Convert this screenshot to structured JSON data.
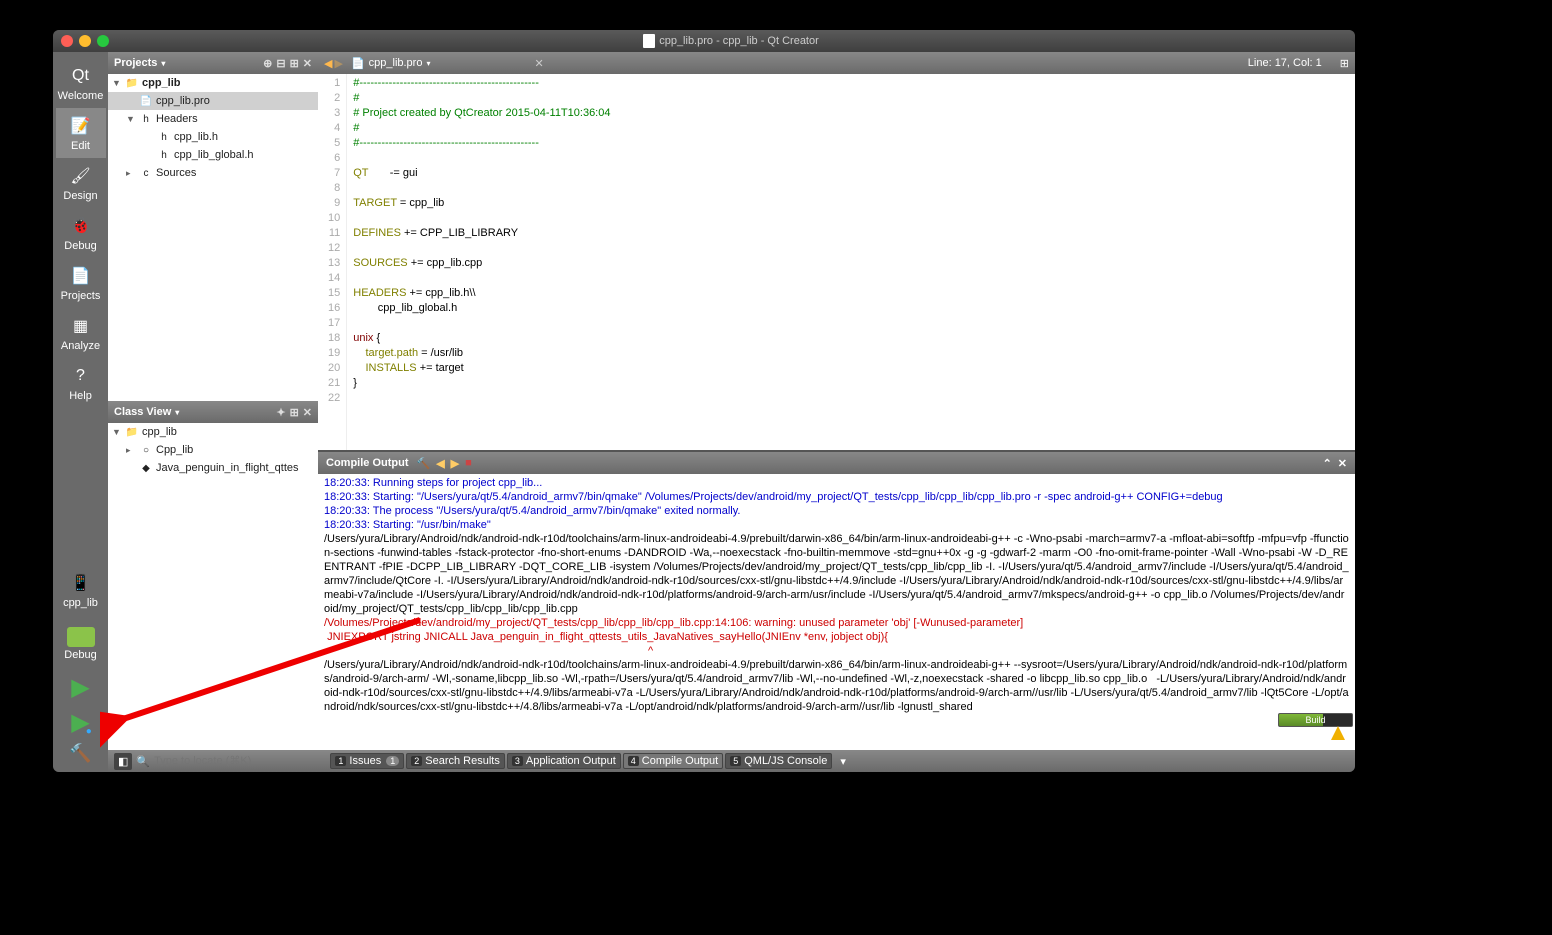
{
  "window": {
    "title": "cpp_lib.pro - cpp_lib - Qt Creator"
  },
  "sidebar": {
    "items": [
      {
        "label": "Welcome",
        "icon": "Qt"
      },
      {
        "label": "Edit",
        "icon": "📝"
      },
      {
        "label": "Design",
        "icon": "🖌"
      },
      {
        "label": "Debug",
        "icon": "🐞"
      },
      {
        "label": "Projects",
        "icon": "📄"
      },
      {
        "label": "Analyze",
        "icon": "▦"
      },
      {
        "label": "Help",
        "icon": "?"
      }
    ],
    "project": "cpp_lib",
    "mode": "Debug"
  },
  "projects_panel": {
    "title": "Projects",
    "tree": [
      {
        "l": 0,
        "arrow": "▼",
        "icon": "📁",
        "name": "cpp_lib",
        "bold": true
      },
      {
        "l": 1,
        "arrow": "",
        "icon": "📄",
        "name": "cpp_lib.pro",
        "sel": true
      },
      {
        "l": 1,
        "arrow": "▼",
        "icon": "h",
        "name": "Headers"
      },
      {
        "l": 2,
        "arrow": "",
        "icon": "h",
        "name": "cpp_lib.h"
      },
      {
        "l": 2,
        "arrow": "",
        "icon": "h",
        "name": "cpp_lib_global.h"
      },
      {
        "l": 1,
        "arrow": "▸",
        "icon": "c",
        "name": "Sources"
      }
    ]
  },
  "classview_panel": {
    "title": "Class View",
    "tree": [
      {
        "l": 0,
        "arrow": "▼",
        "icon": "📁",
        "name": "cpp_lib"
      },
      {
        "l": 1,
        "arrow": "▸",
        "icon": "○",
        "name": "Cpp_lib"
      },
      {
        "l": 1,
        "arrow": "",
        "icon": "◆",
        "name": "Java_penguin_in_flight_qttes"
      }
    ]
  },
  "editor": {
    "tab": "cpp_lib.pro",
    "cursor": "Line: 17, Col: 1",
    "lines": [
      {
        "n": 1,
        "t": "#-------------------------------------------------",
        "cls": "c-green"
      },
      {
        "n": 2,
        "t": "#",
        "cls": "c-green"
      },
      {
        "n": 3,
        "t": "# Project created by QtCreator 2015-04-11T10:36:04",
        "cls": "c-green"
      },
      {
        "n": 4,
        "t": "#",
        "cls": "c-green"
      },
      {
        "n": 5,
        "t": "#-------------------------------------------------",
        "cls": "c-green"
      },
      {
        "n": 6,
        "t": "",
        "cls": ""
      },
      {
        "n": 7,
        "html": "<span class='c-olive'>QT</span>       -= gui"
      },
      {
        "n": 8,
        "t": "",
        "cls": ""
      },
      {
        "n": 9,
        "html": "<span class='c-olive'>TARGET</span> = cpp_lib"
      },
      {
        "n": 10,
        "t": "",
        "cls": ""
      },
      {
        "n": 11,
        "html": "<span class='c-olive'>DEFINES</span> += CPP_LIB_LIBRARY"
      },
      {
        "n": 12,
        "t": "",
        "cls": ""
      },
      {
        "n": 13,
        "html": "<span class='c-olive'>SOURCES</span> += cpp_lib.cpp"
      },
      {
        "n": 14,
        "t": "",
        "cls": ""
      },
      {
        "n": 15,
        "html": "<span class='c-olive'>HEADERS</span> += cpp_lib.h\\\\"
      },
      {
        "n": 16,
        "t": "        cpp_lib_global.h",
        "cls": ""
      },
      {
        "n": 17,
        "t": "",
        "cls": ""
      },
      {
        "n": 18,
        "html": "<span class='c-maroon'>unix</span> {"
      },
      {
        "n": 19,
        "html": "    <span class='c-olive'>target.path</span> = /usr/lib"
      },
      {
        "n": 20,
        "html": "    <span class='c-olive'>INSTALLS</span> += target"
      },
      {
        "n": 21,
        "t": "}",
        "cls": ""
      },
      {
        "n": 22,
        "t": "",
        "cls": ""
      }
    ]
  },
  "output": {
    "title": "Compile Output",
    "lines": [
      {
        "c": "o-blue",
        "t": "18:20:33: Running steps for project cpp_lib..."
      },
      {
        "c": "o-blue",
        "t": "18:20:33: Starting: \"/Users/yura/qt/5.4/android_armv7/bin/qmake\" /Volumes/Projects/dev/android/my_project/QT_tests/cpp_lib/cpp_lib/cpp_lib.pro -r -spec android-g++ CONFIG+=debug"
      },
      {
        "c": "o-blue",
        "t": "18:20:33: The process \"/Users/yura/qt/5.4/android_armv7/bin/qmake\" exited normally."
      },
      {
        "c": "o-blue",
        "t": "18:20:33: Starting: \"/usr/bin/make\" "
      },
      {
        "c": "",
        "t": "/Users/yura/Library/Android/ndk/android-ndk-r10d/toolchains/arm-linux-androideabi-4.9/prebuilt/darwin-x86_64/bin/arm-linux-androideabi-g++ -c -Wno-psabi -march=armv7-a -mfloat-abi=softfp -mfpu=vfp -ffunction-sections -funwind-tables -fstack-protector -fno-short-enums -DANDROID -Wa,--noexecstack -fno-builtin-memmove -std=gnu++0x -g -g -gdwarf-2 -marm -O0 -fno-omit-frame-pointer -Wall -Wno-psabi -W -D_REENTRANT -fPIE -DCPP_LIB_LIBRARY -DQT_CORE_LIB -isystem /Volumes/Projects/dev/android/my_project/QT_tests/cpp_lib/cpp_lib -I. -I/Users/yura/qt/5.4/android_armv7/include -I/Users/yura/qt/5.4/android_armv7/include/QtCore -I. -I/Users/yura/Library/Android/ndk/android-ndk-r10d/sources/cxx-stl/gnu-libstdc++/4.9/include -I/Users/yura/Library/Android/ndk/android-ndk-r10d/sources/cxx-stl/gnu-libstdc++/4.9/libs/armeabi-v7a/include -I/Users/yura/Library/Android/ndk/android-ndk-r10d/platforms/android-9/arch-arm/usr/include -I/Users/yura/qt/5.4/android_armv7/mkspecs/android-g++ -o cpp_lib.o /Volumes/Projects/dev/android/my_project/QT_tests/cpp_lib/cpp_lib/cpp_lib.cpp"
      },
      {
        "c": "o-red",
        "t": "/Volumes/Projects/dev/android/my_project/QT_tests/cpp_lib/cpp_lib/cpp_lib.cpp:14:106: warning: unused parameter 'obj' [-Wunused-parameter]"
      },
      {
        "c": "o-red",
        "t": " JNIEXPORT jstring JNICALL Java_penguin_in_flight_qttests_utils_JavaNatives_sayHello(JNIEnv *env, jobject obj){"
      },
      {
        "c": "o-red",
        "t": "                                                                                                          ^"
      },
      {
        "c": "",
        "t": "/Users/yura/Library/Android/ndk/android-ndk-r10d/toolchains/arm-linux-androideabi-4.9/prebuilt/darwin-x86_64/bin/arm-linux-androideabi-g++ --sysroot=/Users/yura/Library/Android/ndk/android-ndk-r10d/platforms/android-9/arch-arm/ -Wl,-soname,libcpp_lib.so -Wl,-rpath=/Users/yura/qt/5.4/android_armv7/lib -Wl,--no-undefined -Wl,-z,noexecstack -shared -o libcpp_lib.so cpp_lib.o   -L/Users/yura/Library/Android/ndk/android-ndk-r10d/sources/cxx-stl/gnu-libstdc++/4.9/libs/armeabi-v7a -L/Users/yura/Library/Android/ndk/android-ndk-r10d/platforms/android-9/arch-arm//usr/lib -L/Users/yura/qt/5.4/android_armv7/lib -lQt5Core -L/opt/android/ndk/sources/cxx-stl/gnu-libstdc++/4.8/libs/armeabi-v7a -L/opt/android/ndk/platforms/android-9/arch-arm//usr/lib -lgnustl_shared"
      }
    ]
  },
  "statusbar": {
    "locator_placeholder": "Type to locate (⌘K)",
    "buttons": [
      {
        "n": "1",
        "label": "Issues",
        "badge": "1"
      },
      {
        "n": "2",
        "label": "Search Results"
      },
      {
        "n": "3",
        "label": "Application Output"
      },
      {
        "n": "4",
        "label": "Compile Output",
        "active": true
      },
      {
        "n": "5",
        "label": "QML/JS Console"
      }
    ],
    "build": "Build"
  }
}
